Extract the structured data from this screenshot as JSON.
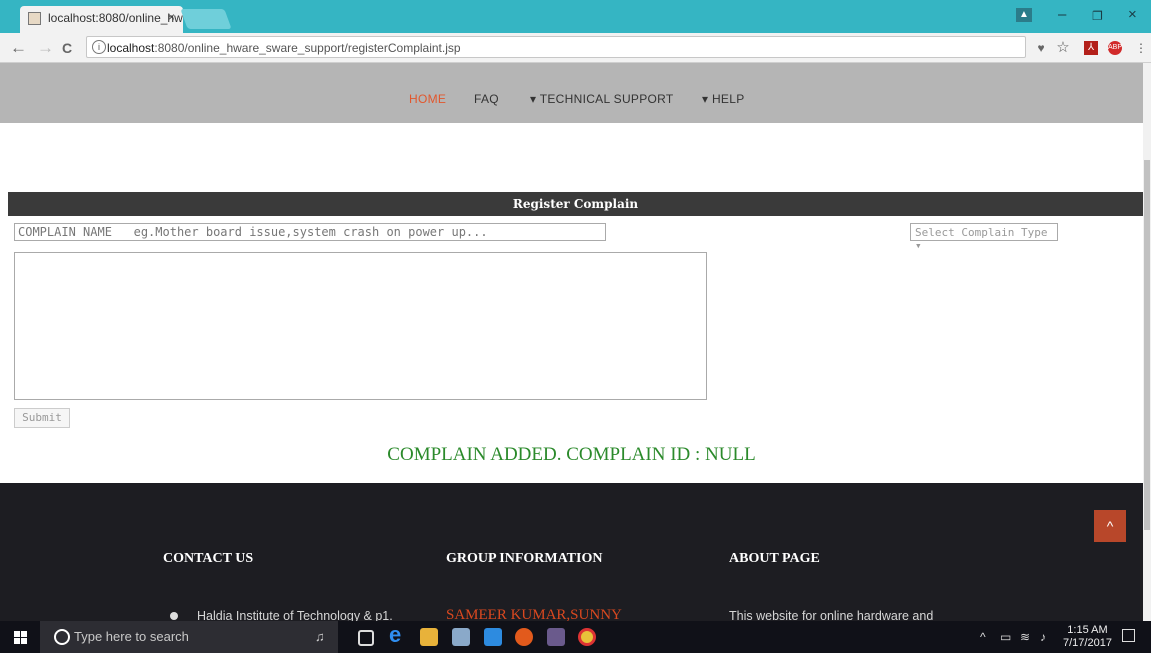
{
  "browser": {
    "tab_title": "localhost:8080/online_hw",
    "tab_close": "×",
    "url_host": "localhost",
    "url_rest": ":8080/online_hware_sware_support/registerComplaint.jsp",
    "win_minimize": "–",
    "win_maximize": "❐",
    "win_close": "×",
    "back": "←",
    "forward": "→",
    "reload": "C",
    "star": "☆",
    "menu": "⋮"
  },
  "nav": {
    "items": [
      {
        "label": "HOME",
        "active": true
      },
      {
        "label": "FAQ"
      },
      {
        "label": "▾ TECHNICAL SUPPORT"
      },
      {
        "label": "▾ HELP"
      }
    ]
  },
  "form": {
    "header": "Register Complain",
    "name_placeholder": "COMPLAIN NAME   eg.Mother board issue,system crash on power up...",
    "type_placeholder": "Select Complain Type ▾",
    "submit_label": "Submit",
    "result_message": "COMPLAIN ADDED. COMPLAIN ID : NULL"
  },
  "footer": {
    "contact_title": "CONTACT US",
    "group_title": "GROUP INFORMATION",
    "about_title": "ABOUT PAGE",
    "contact_address": "Haldia Institute of Technology & p1.",
    "group_member": "SAMEER KUMAR,SUNNY",
    "about_text": "This website for online hardware and"
  },
  "taskbar": {
    "search_placeholder": "Type here to search",
    "time": "1:15 AM",
    "date": "7/17/2017"
  },
  "colors": {
    "tabstrip": "#35b5c3",
    "nav_bg": "#b5b5b5",
    "nav_active": "#e2572d",
    "panel_header": "#3a3a3a",
    "result_green": "#2b8a2b",
    "footer_bg": "#1d1d22",
    "footer_accent": "#d9481f"
  }
}
